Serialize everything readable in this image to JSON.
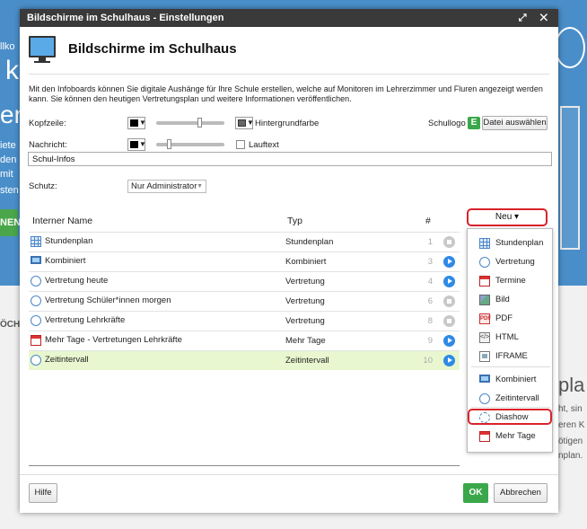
{
  "background": {
    "left_fragments": [
      "llko",
      "k",
      "en",
      "iete",
      "den",
      "mit",
      "sten"
    ],
    "green_button": "NEN",
    "bottom_left": "ÖCH",
    "right_fragments": [
      "pla",
      "ht, sin",
      "eren K",
      "ötigen",
      "nplan."
    ]
  },
  "window": {
    "title": "Bildschirme im Schulhaus - Einstellungen",
    "controls": "⤢ ✕"
  },
  "header": {
    "title": "Bildschirme im Schulhaus"
  },
  "intro": "Mit den Infoboards können Sie digitale Aushänge für Ihre Schule erstellen, welche auf Monitoren im Lehrerzimmer und Fluren angezeigt werden kann. Sie können den heutigen Vertretungsplan und weitere Informationen veröffentlichen.",
  "settings": {
    "kopfzeile_label": "Kopfzeile:",
    "hintergrund_label": "Hintergrundfarbe",
    "schullogo_label": "Schullogo",
    "logo_icon": "E",
    "datei_button": "Datei auswählen",
    "nachricht_label": "Nachricht:",
    "lauftext_label": "Lauftext",
    "message_value": "Schul-Infos",
    "schutz_label": "Schutz:",
    "schutz_value": "Nur Administrator",
    "kopfzeile_slider": 0.65,
    "nachricht_slider": 0.2
  },
  "table": {
    "headers": {
      "name": "Interner Name",
      "type": "Typ",
      "num": "#"
    },
    "rows": [
      {
        "icon": "grid-icon",
        "name": "Stundenplan",
        "type": "Stundenplan",
        "num": "1",
        "status": "stopped"
      },
      {
        "icon": "monitor-icon",
        "name": "Kombiniert",
        "type": "Kombiniert",
        "num": "3",
        "status": "active"
      },
      {
        "icon": "swap-icon",
        "name": "Vertretung heute",
        "type": "Vertretung",
        "num": "4",
        "status": "active"
      },
      {
        "icon": "swap-icon",
        "name": "Vertretung Schüler*innen morgen",
        "type": "Vertretung",
        "num": "6",
        "status": "stopped"
      },
      {
        "icon": "swap-icon",
        "name": "Vertretung Lehrkräfte",
        "type": "Vertretung",
        "num": "8",
        "status": "stopped"
      },
      {
        "icon": "calendar-add-icon",
        "name": "Mehr Tage - Vertretungen Lehrkräfte",
        "type": "Mehr Tage",
        "num": "9",
        "status": "active"
      },
      {
        "icon": "clock-icon",
        "name": "Zeitintervall",
        "type": "Zeitintervall",
        "num": "10",
        "status": "active",
        "selected": true
      }
    ]
  },
  "new_menu": {
    "button": "Neu ▾",
    "items": [
      {
        "icon": "grid-icon",
        "label": "Stundenplan"
      },
      {
        "icon": "swap-icon",
        "label": "Vertretung"
      },
      {
        "icon": "calendar-icon",
        "label": "Termine"
      },
      {
        "icon": "image-icon",
        "label": "Bild"
      },
      {
        "icon": "pdf-icon",
        "label": "PDF"
      },
      {
        "icon": "html-icon",
        "label": "HTML"
      },
      {
        "icon": "iframe-icon",
        "label": "IFRAME"
      },
      {
        "icon": "monitor-icon",
        "label": "Kombiniert"
      },
      {
        "icon": "clock-icon",
        "label": "Zeitintervall"
      },
      {
        "icon": "cycle-icon",
        "label": "Diashow",
        "highlighted": true
      },
      {
        "icon": "calendar-add-icon",
        "label": "Mehr Tage"
      }
    ]
  },
  "footer": {
    "help": "Hilfe",
    "ok": "OK",
    "cancel": "Abbrechen"
  },
  "colors": {
    "accent_green": "#3aa84a",
    "highlight_red": "#d9232a",
    "selected_row": "#e8f7cf",
    "play_blue": "#2e8ae6"
  }
}
